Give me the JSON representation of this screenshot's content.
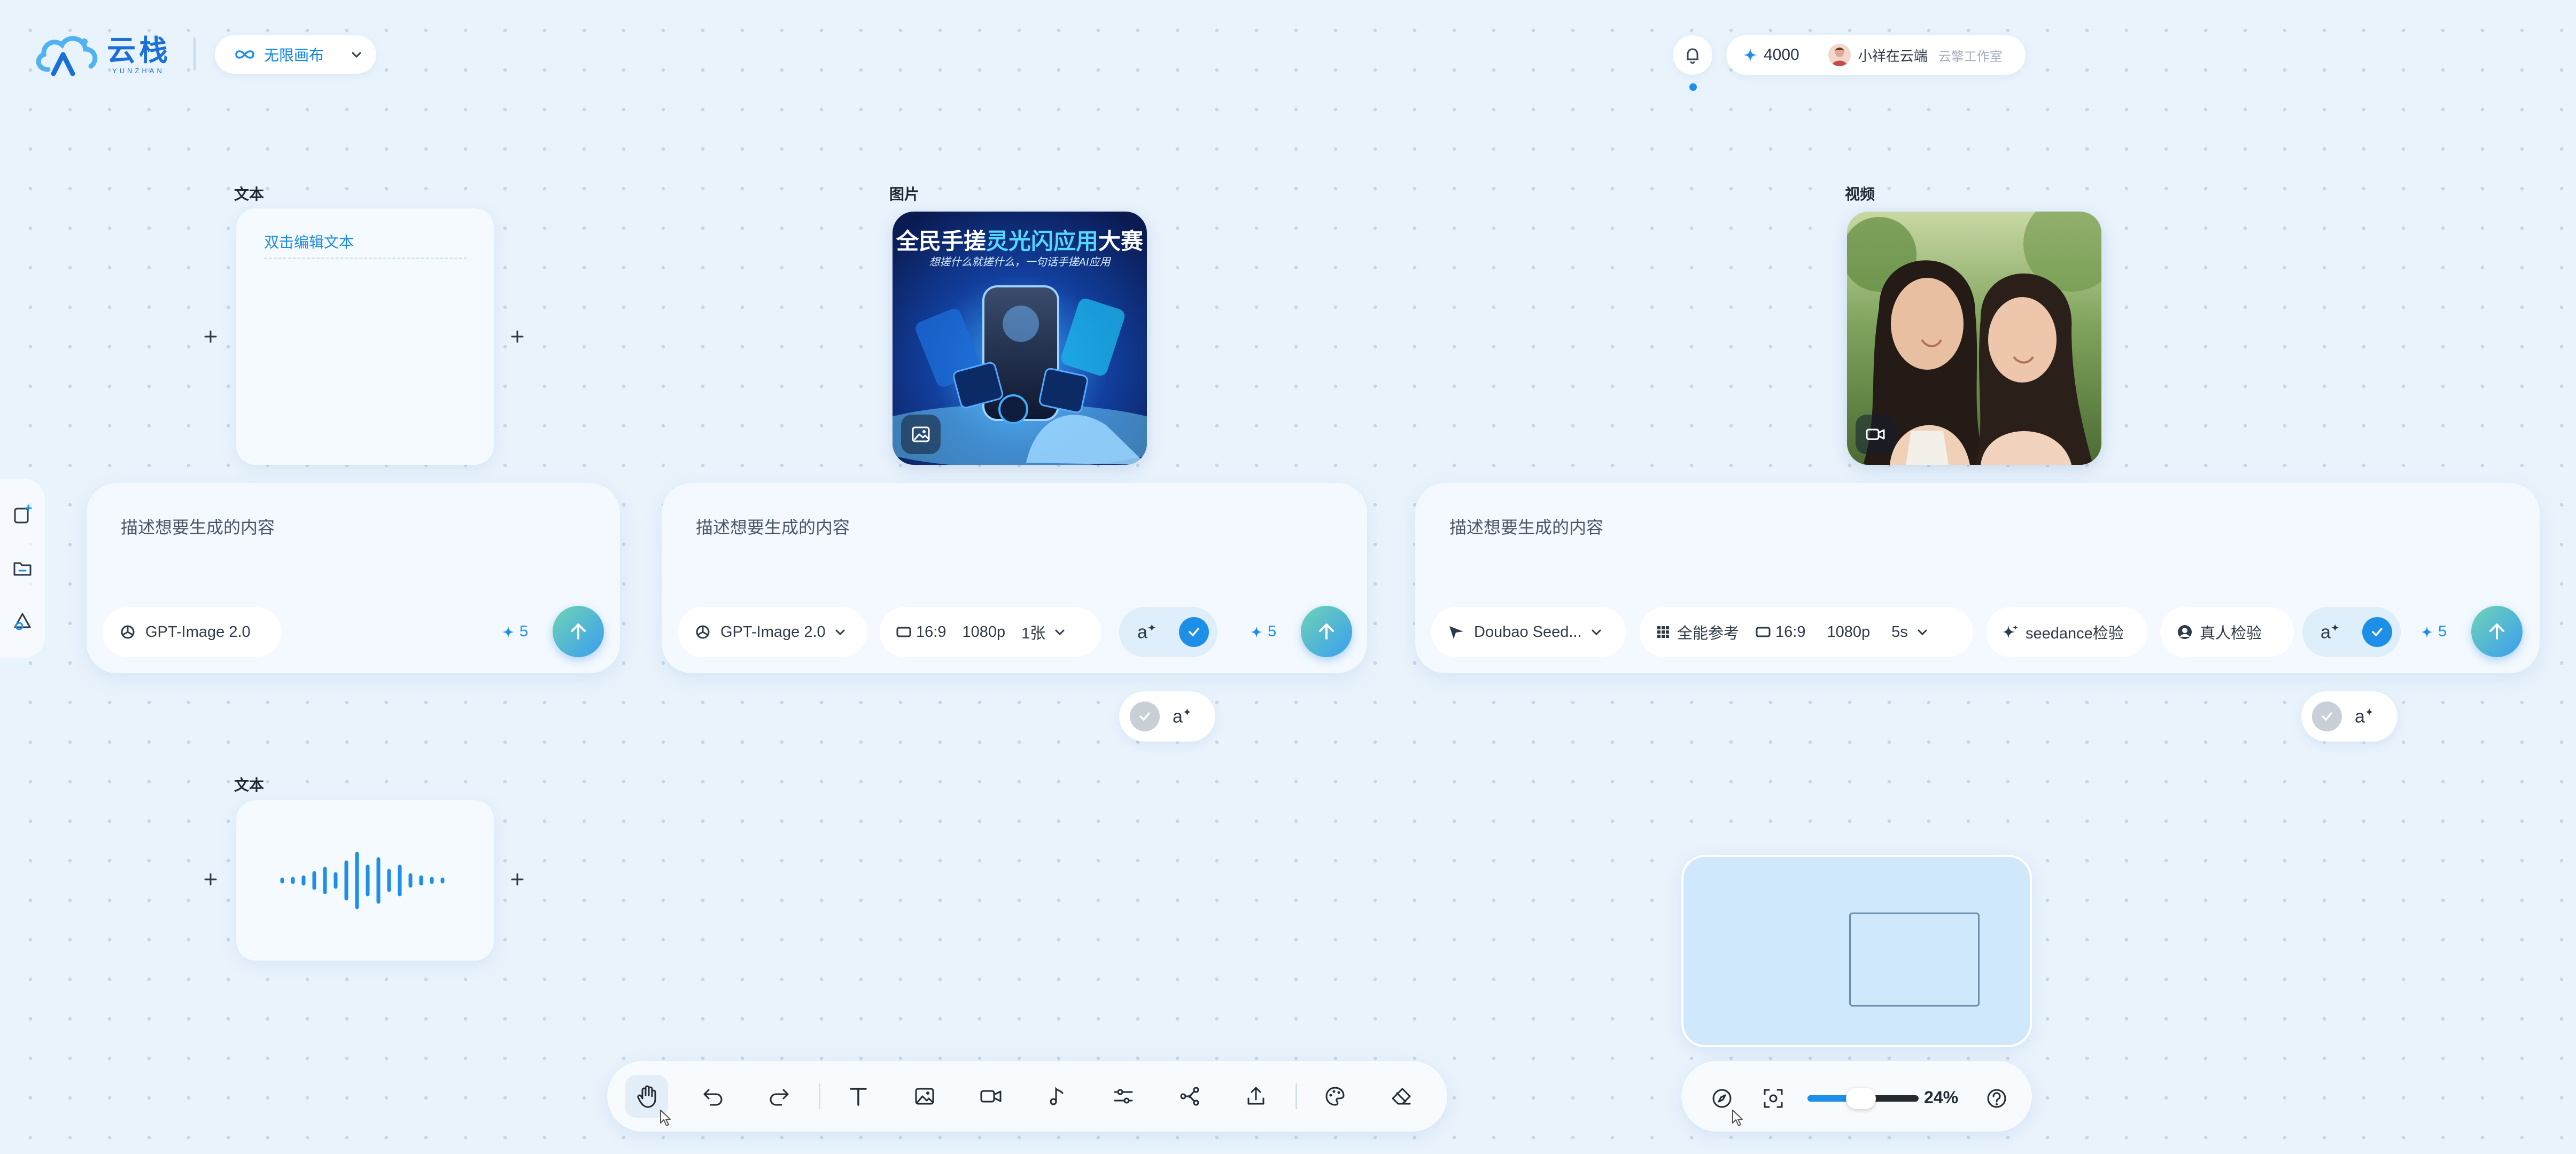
{
  "brand": {
    "name_cn": "云栈",
    "name_en": "YUNZHAN",
    "color": "#1a6fd8"
  },
  "canvas_selector": {
    "label": "无限画布",
    "icon": "infinity-icon"
  },
  "header": {
    "credits": "4000",
    "username": "小祥在云端",
    "workspace": "云擎工作室"
  },
  "left_rail": {
    "icons": [
      "add-node-icon",
      "folder-icon",
      "shapes-icon"
    ]
  },
  "nodes": {
    "text1": {
      "label": "文本",
      "placeholder": "双击编辑文本"
    },
    "image": {
      "label": "图片",
      "poster_title_a": "全民手搓",
      "poster_title_b": "灵光闪应用",
      "poster_title_c": "大赛",
      "poster_subtitle": "想搓什么就搓什么，一句话手搓AI应用",
      "badge_icon": "image-icon"
    },
    "video": {
      "label": "视频",
      "badge_icon": "video-camera-icon"
    },
    "text2": {
      "label": "文本",
      "content_icon": "audio-waveform-icon"
    }
  },
  "panels": {
    "text": {
      "prompt": "描述想要生成的内容",
      "model": "GPT-Image 2.0",
      "cost": "5"
    },
    "image": {
      "prompt": "描述想要生成的内容",
      "model": "GPT-Image 2.0",
      "ratio": "16:9",
      "resolution": "1080p",
      "count": "1张",
      "cost": "5"
    },
    "video": {
      "prompt": "描述想要生成的内容",
      "model": "Doubao Seed...",
      "reference": "全能参考",
      "ratio": "16:9",
      "resolution": "1080p",
      "duration": "5s",
      "check1": "seedance检验",
      "check2": "真人检验",
      "cost": "5"
    }
  },
  "ai_toggle_label": "a",
  "toolbar": {
    "tools": [
      "hand-icon",
      "undo-icon",
      "redo-icon",
      "text-icon",
      "image-icon",
      "video-icon",
      "music-icon",
      "adjust-icon",
      "workflow-icon",
      "upload-icon",
      "palette-icon",
      "eraser-icon"
    ],
    "active": "hand-icon"
  },
  "zoom": {
    "value": "24%",
    "level": 0.24
  },
  "colors": {
    "accent": "#1e8fe8",
    "send_gradient_start": "#6fd3b5",
    "send_gradient_end": "#3a9ef0"
  }
}
